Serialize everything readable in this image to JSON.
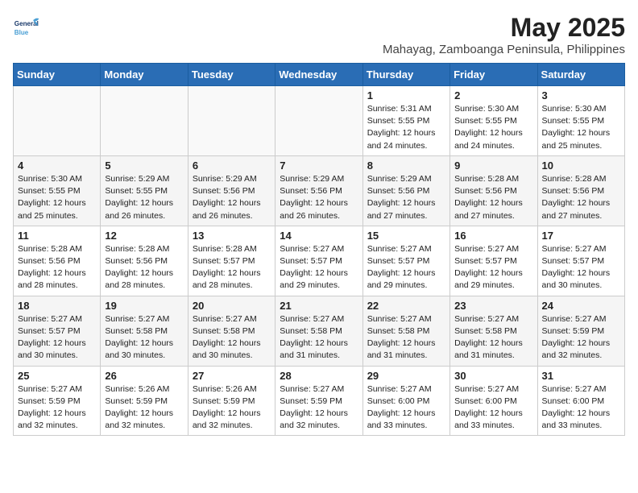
{
  "logo": {
    "line1": "General",
    "line2": "Blue"
  },
  "title": "May 2025",
  "subtitle": "Mahayag, Zamboanga Peninsula, Philippines",
  "days_of_week": [
    "Sunday",
    "Monday",
    "Tuesday",
    "Wednesday",
    "Thursday",
    "Friday",
    "Saturday"
  ],
  "weeks": [
    [
      {
        "day": "",
        "info": ""
      },
      {
        "day": "",
        "info": ""
      },
      {
        "day": "",
        "info": ""
      },
      {
        "day": "",
        "info": ""
      },
      {
        "day": "1",
        "info": "Sunrise: 5:31 AM\nSunset: 5:55 PM\nDaylight: 12 hours\nand 24 minutes."
      },
      {
        "day": "2",
        "info": "Sunrise: 5:30 AM\nSunset: 5:55 PM\nDaylight: 12 hours\nand 24 minutes."
      },
      {
        "day": "3",
        "info": "Sunrise: 5:30 AM\nSunset: 5:55 PM\nDaylight: 12 hours\nand 25 minutes."
      }
    ],
    [
      {
        "day": "4",
        "info": "Sunrise: 5:30 AM\nSunset: 5:55 PM\nDaylight: 12 hours\nand 25 minutes."
      },
      {
        "day": "5",
        "info": "Sunrise: 5:29 AM\nSunset: 5:55 PM\nDaylight: 12 hours\nand 26 minutes."
      },
      {
        "day": "6",
        "info": "Sunrise: 5:29 AM\nSunset: 5:56 PM\nDaylight: 12 hours\nand 26 minutes."
      },
      {
        "day": "7",
        "info": "Sunrise: 5:29 AM\nSunset: 5:56 PM\nDaylight: 12 hours\nand 26 minutes."
      },
      {
        "day": "8",
        "info": "Sunrise: 5:29 AM\nSunset: 5:56 PM\nDaylight: 12 hours\nand 27 minutes."
      },
      {
        "day": "9",
        "info": "Sunrise: 5:28 AM\nSunset: 5:56 PM\nDaylight: 12 hours\nand 27 minutes."
      },
      {
        "day": "10",
        "info": "Sunrise: 5:28 AM\nSunset: 5:56 PM\nDaylight: 12 hours\nand 27 minutes."
      }
    ],
    [
      {
        "day": "11",
        "info": "Sunrise: 5:28 AM\nSunset: 5:56 PM\nDaylight: 12 hours\nand 28 minutes."
      },
      {
        "day": "12",
        "info": "Sunrise: 5:28 AM\nSunset: 5:56 PM\nDaylight: 12 hours\nand 28 minutes."
      },
      {
        "day": "13",
        "info": "Sunrise: 5:28 AM\nSunset: 5:57 PM\nDaylight: 12 hours\nand 28 minutes."
      },
      {
        "day": "14",
        "info": "Sunrise: 5:27 AM\nSunset: 5:57 PM\nDaylight: 12 hours\nand 29 minutes."
      },
      {
        "day": "15",
        "info": "Sunrise: 5:27 AM\nSunset: 5:57 PM\nDaylight: 12 hours\nand 29 minutes."
      },
      {
        "day": "16",
        "info": "Sunrise: 5:27 AM\nSunset: 5:57 PM\nDaylight: 12 hours\nand 29 minutes."
      },
      {
        "day": "17",
        "info": "Sunrise: 5:27 AM\nSunset: 5:57 PM\nDaylight: 12 hours\nand 30 minutes."
      }
    ],
    [
      {
        "day": "18",
        "info": "Sunrise: 5:27 AM\nSunset: 5:57 PM\nDaylight: 12 hours\nand 30 minutes."
      },
      {
        "day": "19",
        "info": "Sunrise: 5:27 AM\nSunset: 5:58 PM\nDaylight: 12 hours\nand 30 minutes."
      },
      {
        "day": "20",
        "info": "Sunrise: 5:27 AM\nSunset: 5:58 PM\nDaylight: 12 hours\nand 30 minutes."
      },
      {
        "day": "21",
        "info": "Sunrise: 5:27 AM\nSunset: 5:58 PM\nDaylight: 12 hours\nand 31 minutes."
      },
      {
        "day": "22",
        "info": "Sunrise: 5:27 AM\nSunset: 5:58 PM\nDaylight: 12 hours\nand 31 minutes."
      },
      {
        "day": "23",
        "info": "Sunrise: 5:27 AM\nSunset: 5:58 PM\nDaylight: 12 hours\nand 31 minutes."
      },
      {
        "day": "24",
        "info": "Sunrise: 5:27 AM\nSunset: 5:59 PM\nDaylight: 12 hours\nand 32 minutes."
      }
    ],
    [
      {
        "day": "25",
        "info": "Sunrise: 5:27 AM\nSunset: 5:59 PM\nDaylight: 12 hours\nand 32 minutes."
      },
      {
        "day": "26",
        "info": "Sunrise: 5:26 AM\nSunset: 5:59 PM\nDaylight: 12 hours\nand 32 minutes."
      },
      {
        "day": "27",
        "info": "Sunrise: 5:26 AM\nSunset: 5:59 PM\nDaylight: 12 hours\nand 32 minutes."
      },
      {
        "day": "28",
        "info": "Sunrise: 5:27 AM\nSunset: 5:59 PM\nDaylight: 12 hours\nand 32 minutes."
      },
      {
        "day": "29",
        "info": "Sunrise: 5:27 AM\nSunset: 6:00 PM\nDaylight: 12 hours\nand 33 minutes."
      },
      {
        "day": "30",
        "info": "Sunrise: 5:27 AM\nSunset: 6:00 PM\nDaylight: 12 hours\nand 33 minutes."
      },
      {
        "day": "31",
        "info": "Sunrise: 5:27 AM\nSunset: 6:00 PM\nDaylight: 12 hours\nand 33 minutes."
      }
    ]
  ]
}
